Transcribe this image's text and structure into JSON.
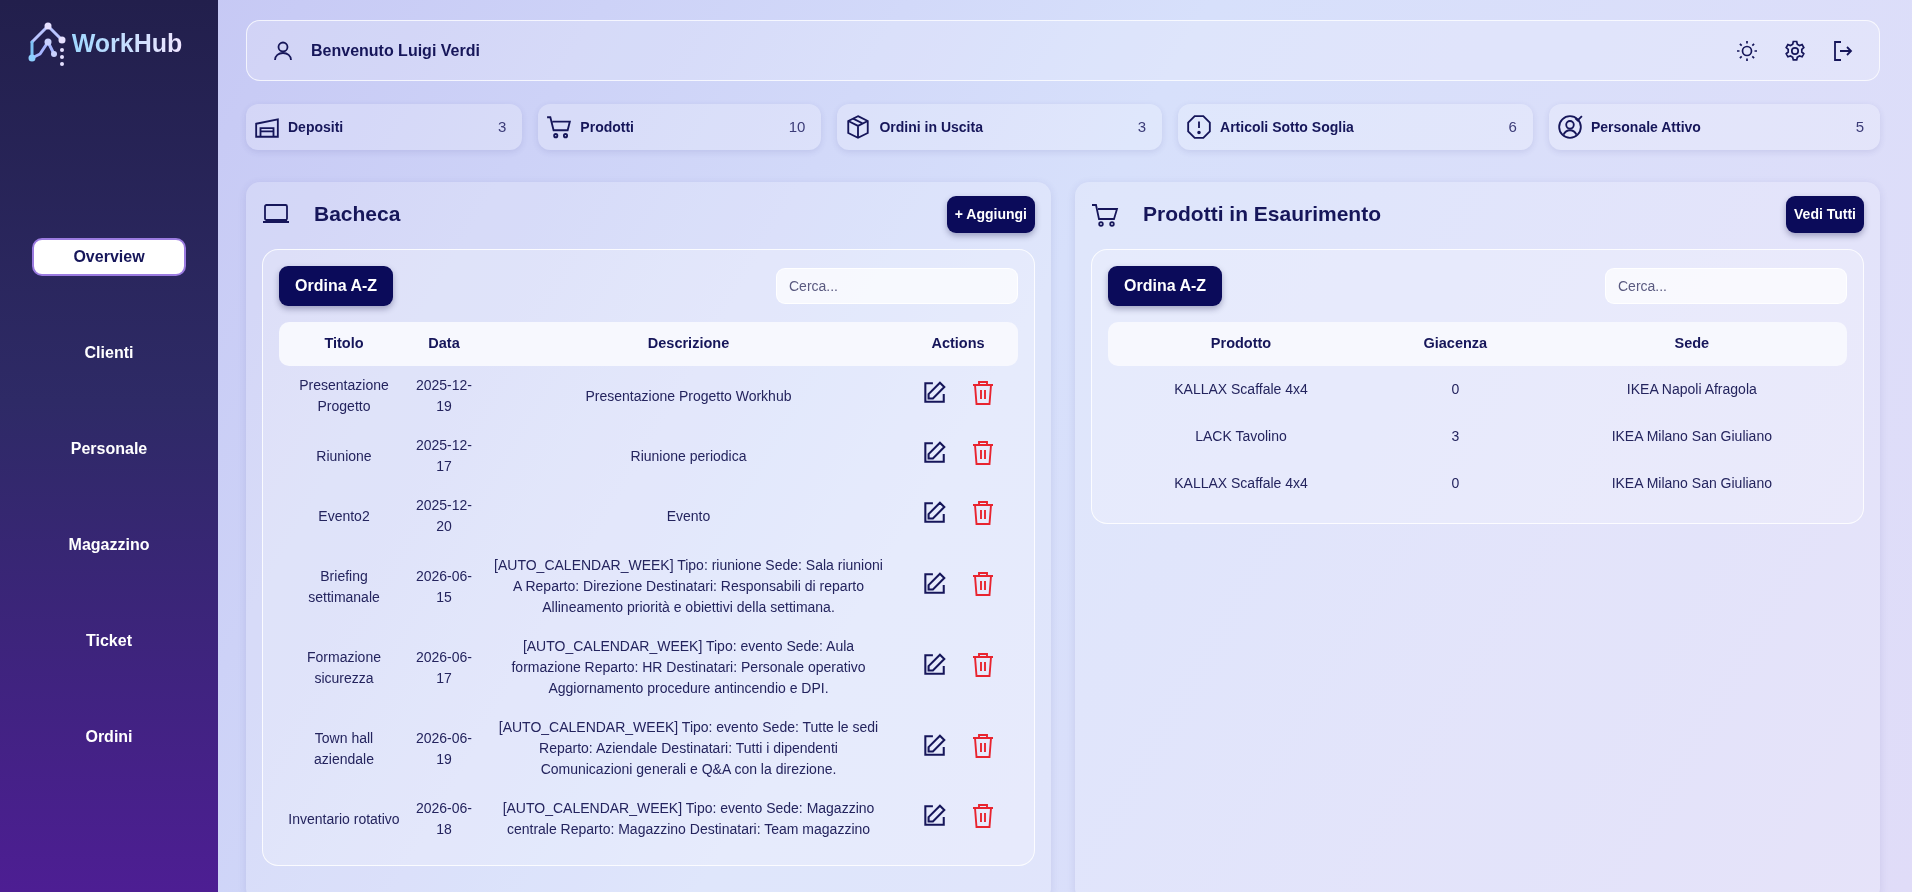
{
  "brand": {
    "name": "WorkHub"
  },
  "sidebar": {
    "items": [
      {
        "label": "Overview",
        "selected": true
      },
      {
        "label": "Clienti",
        "selected": false
      },
      {
        "label": "Personale",
        "selected": false
      },
      {
        "label": "Magazzino",
        "selected": false
      },
      {
        "label": "Ticket",
        "selected": false
      },
      {
        "label": "Ordini",
        "selected": false
      }
    ]
  },
  "header": {
    "welcome": "Benvenuto Luigi Verdi"
  },
  "stats": [
    {
      "label": "Depositi",
      "count": "3"
    },
    {
      "label": "Prodotti",
      "count": "10"
    },
    {
      "label": "Ordini in Uscita",
      "count": "3"
    },
    {
      "label": "Articoli Sotto Soglia",
      "count": "6"
    },
    {
      "label": "Personale Attivo",
      "count": "5"
    }
  ],
  "board": {
    "title": "Bacheca",
    "add_button": "+ Aggiungi",
    "sort_button": "Ordina A-Z",
    "search": {
      "placeholder": "Cerca..."
    },
    "columns": [
      "Titolo",
      "Data",
      "Descrizione",
      "Actions"
    ],
    "rows": [
      {
        "title": "Presentazione Progetto",
        "date": "2025-12-19",
        "description": "Presentazione Progetto Workhub"
      },
      {
        "title": "Riunione",
        "date": "2025-12-17",
        "description": "Riunione periodica"
      },
      {
        "title": "Evento2",
        "date": "2025-12-20",
        "description": "Evento"
      },
      {
        "title": "Briefing settimanale",
        "date": "2026-06-15",
        "description": "[AUTO_CALENDAR_WEEK] Tipo: riunione Sede: Sala riunioni A Reparto: Direzione Destinatari: Responsabili di reparto Allineamento priorità e obiettivi della settimana."
      },
      {
        "title": "Formazione sicurezza",
        "date": "2026-06-17",
        "description": "[AUTO_CALENDAR_WEEK] Tipo: evento Sede: Aula formazione Reparto: HR Destinatari: Personale operativo Aggiornamento procedure antincendio e DPI."
      },
      {
        "title": "Town hall aziendale",
        "date": "2026-06-19",
        "description": "[AUTO_CALENDAR_WEEK] Tipo: evento Sede: Tutte le sedi Reparto: Aziendale Destinatari: Tutti i dipendenti Comunicazioni generali e Q&A con la direzione."
      },
      {
        "title": "Inventario rotativo",
        "date": "2026-06-18",
        "description": "[AUTO_CALENDAR_WEEK] Tipo: evento Sede: Magazzino centrale Reparto: Magazzino Destinatari: Team magazzino"
      }
    ]
  },
  "low_stock": {
    "title": "Prodotti in Esaurimento",
    "all_button": "Vedi Tutti",
    "sort_button": "Ordina A-Z",
    "search": {
      "placeholder": "Cerca..."
    },
    "columns": [
      "Prodotto",
      "Giacenza",
      "Sede"
    ],
    "rows": [
      {
        "product": "KALLAX Scaffale 4x4",
        "stock": "0",
        "site": "IKEA Napoli Afragola"
      },
      {
        "product": "LACK Tavolino",
        "stock": "3",
        "site": "IKEA Milano San Giuliano"
      },
      {
        "product": "KALLAX Scaffale 4x4",
        "stock": "0",
        "site": "IKEA Milano San Giuliano"
      }
    ]
  }
}
